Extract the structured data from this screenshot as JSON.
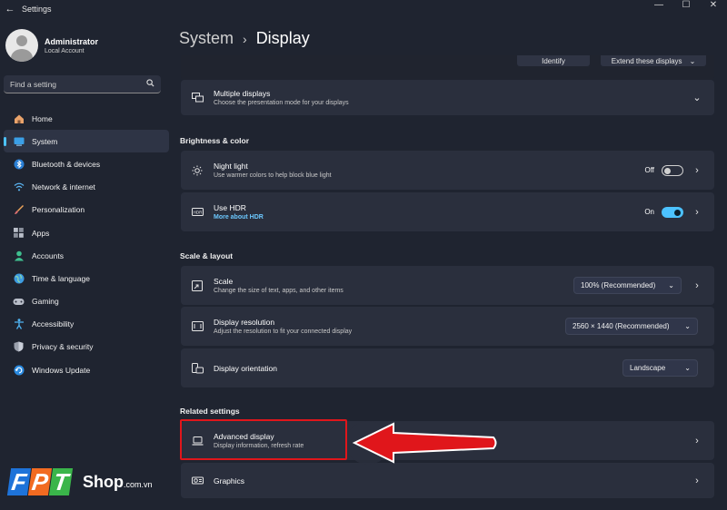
{
  "window": {
    "title": "Settings"
  },
  "profile": {
    "name": "Administrator",
    "account_type": "Local Account"
  },
  "search": {
    "placeholder": "Find a setting"
  },
  "nav": [
    {
      "label": "Home",
      "icon": "home-icon",
      "active": false
    },
    {
      "label": "System",
      "icon": "system-icon",
      "active": true
    },
    {
      "label": "Bluetooth & devices",
      "icon": "bluetooth-icon",
      "active": false
    },
    {
      "label": "Network & internet",
      "icon": "wifi-icon",
      "active": false
    },
    {
      "label": "Personalization",
      "icon": "brush-icon",
      "active": false
    },
    {
      "label": "Apps",
      "icon": "apps-icon",
      "active": false
    },
    {
      "label": "Accounts",
      "icon": "accounts-icon",
      "active": false
    },
    {
      "label": "Time & language",
      "icon": "globe-icon",
      "active": false
    },
    {
      "label": "Gaming",
      "icon": "gamepad-icon",
      "active": false
    },
    {
      "label": "Accessibility",
      "icon": "accessibility-icon",
      "active": false
    },
    {
      "label": "Privacy & security",
      "icon": "shield-icon",
      "active": false
    },
    {
      "label": "Windows Update",
      "icon": "update-icon",
      "active": false
    }
  ],
  "breadcrumb": {
    "parent": "System",
    "current": "Display"
  },
  "top_strip": {
    "identify": "Identify",
    "extend": "Extend these displays"
  },
  "multiple_displays": {
    "title": "Multiple displays",
    "subtitle": "Choose the presentation mode for your displays"
  },
  "brightness_section": {
    "title": "Brightness & color"
  },
  "night_light": {
    "title": "Night light",
    "subtitle": "Use warmer colors to help block blue light",
    "state": "Off"
  },
  "hdr": {
    "title": "Use HDR",
    "subtitle": "More about HDR",
    "state": "On"
  },
  "scale_section": {
    "title": "Scale & layout"
  },
  "scale": {
    "title": "Scale",
    "subtitle": "Change the size of text, apps, and other items",
    "value": "100% (Recommended)"
  },
  "resolution": {
    "title": "Display resolution",
    "subtitle": "Adjust the resolution to fit your connected display",
    "value": "2560 × 1440 (Recommended)"
  },
  "orientation": {
    "title": "Display orientation",
    "value": "Landscape"
  },
  "related_section": {
    "title": "Related settings"
  },
  "advanced_display": {
    "title": "Advanced display",
    "subtitle": "Display information, refresh rate"
  },
  "graphics": {
    "title": "Graphics"
  },
  "brand": {
    "letters": [
      "F",
      "P",
      "T"
    ],
    "name": "Shop",
    "domain": ".com.vn"
  },
  "colors": {
    "accent": "#4cc2ff",
    "highlight": "#e0161b",
    "background": "#1f2430",
    "card": "#2a2f3d"
  }
}
